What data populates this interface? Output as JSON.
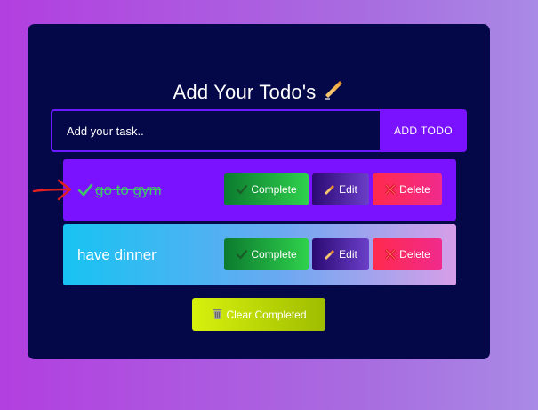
{
  "app": {
    "title": "Add Your Todo's",
    "title_icon": "writing-hand-icon"
  },
  "add_form": {
    "placeholder": "Add your task..",
    "value": "",
    "button_label": "ADD TODO"
  },
  "todos": [
    {
      "text": "go to gym",
      "completed": true,
      "complete_label": "Complete",
      "edit_label": "Edit",
      "delete_label": "Delete"
    },
    {
      "text": "have dinner",
      "completed": false,
      "complete_label": "Complete",
      "edit_label": "Edit",
      "delete_label": "Delete"
    }
  ],
  "clear_button": {
    "label": "Clear Completed",
    "icon": "trash-icon"
  },
  "annotation": {
    "icon": "red-arrow-icon",
    "color": "#e0201e"
  },
  "colors": {
    "card_bg": "#050848",
    "accent": "#7a12ff",
    "completed_text": "#3fc46b"
  }
}
